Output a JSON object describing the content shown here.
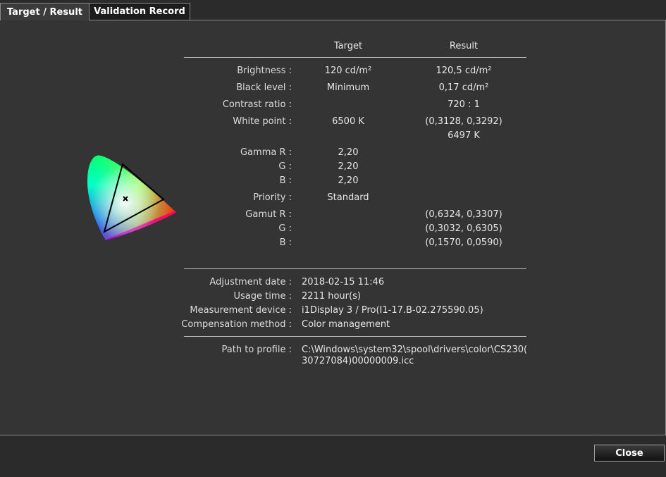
{
  "tabs": [
    {
      "label": "Target / Result",
      "active": true
    },
    {
      "label": "Validation Record",
      "active": false
    }
  ],
  "columns": {
    "target": "Target",
    "result": "Result"
  },
  "rows": {
    "brightness": {
      "label": "Brightness :",
      "target": "120 cd/m²",
      "result": "120,5 cd/m²"
    },
    "black_level": {
      "label": "Black level :",
      "target": "Minimum",
      "result": "0,17 cd/m²"
    },
    "contrast_ratio": {
      "label": "Contrast ratio :",
      "target": "",
      "result": "720 : 1"
    },
    "white_point": {
      "label": "White point :",
      "target": "6500 K",
      "result": "(0,3128, 0,3292)",
      "result2": "6497 K"
    },
    "gamma_r": {
      "label": "Gamma R :",
      "target": "2,20"
    },
    "gamma_g": {
      "label": "G :",
      "target": "2,20"
    },
    "gamma_b": {
      "label": "B :",
      "target": "2,20"
    },
    "priority": {
      "label": "Priority :",
      "target": "Standard"
    },
    "gamut_r": {
      "label": "Gamut R :",
      "result": "(0,6324, 0,3307)"
    },
    "gamut_g": {
      "label": "G :",
      "result": "(0,3032, 0,6305)"
    },
    "gamut_b": {
      "label": "B :",
      "result": "(0,1570, 0,0590)"
    }
  },
  "info": {
    "adjustment_date": {
      "label": "Adjustment date :",
      "value": "2018-02-15 11:46"
    },
    "usage_time": {
      "label": "Usage time :",
      "value": "2211 hour(s)"
    },
    "measurement_device": {
      "label": "Measurement device :",
      "value": "i1Display 3 / Pro(I1-17.B-02.275590.05)"
    },
    "compensation_method": {
      "label": "Compensation method :",
      "value": "Color management"
    },
    "path_to_profile": {
      "label": "Path to profile :",
      "value_line1": "C:\\Windows\\system32\\spool\\drivers\\color\\CS230(",
      "value_line2": "30727084)00000009.icc"
    }
  },
  "buttons": {
    "close": "Close"
  }
}
